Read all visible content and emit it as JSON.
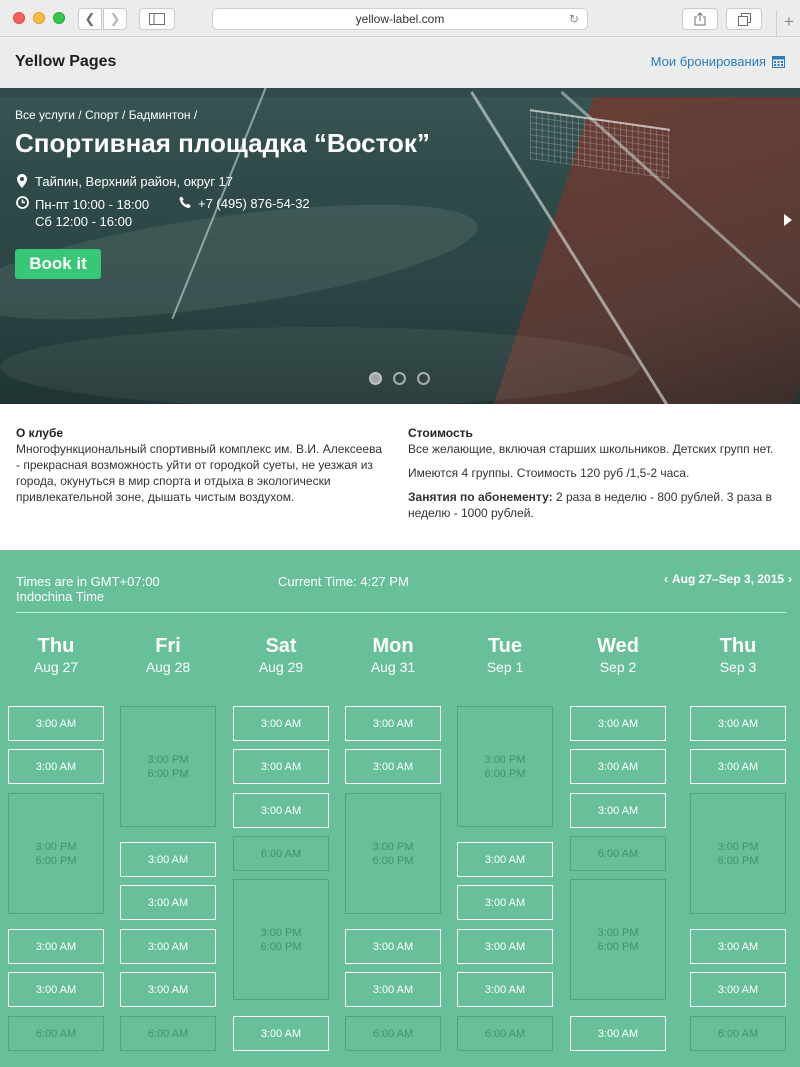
{
  "browser": {
    "url": "yellow-label.com",
    "newtab": "+"
  },
  "header": {
    "logo": "Yellow Pages",
    "my_bookings": "Мои бронирования"
  },
  "hero": {
    "breadcrumb": "Все услуги / Спорт / Бадминтон /",
    "title": "Спортивная площадка “Восток”",
    "address": "Тайпин, Верхний район, округ 17",
    "hours_1": "Пн-пт 10:00 - 18:00",
    "hours_2": "Сб 12:00 - 16:00",
    "phone": "+7 (495) 876-54-32",
    "book_label": "Book it",
    "active_slide": 1,
    "slide_count": 3
  },
  "about": {
    "heading": "О клубе",
    "text": "Многофункциональный спортивный комплекс им. В.И. Алексеева - прекрасная возможность уйти от городкой суеты, не уезжая из города, окунуться в мир спорта и отдыха в экологически привлекательной зоне, дышать чистым воздухом."
  },
  "price": {
    "heading": "Стоимость",
    "line1": "Все желающие, включая старших школьников. Детских групп нет.",
    "line2": "Имеются 4 группы. Стоимость 120 руб /1,5-2 часа.",
    "line3_bold": "Занятия по абонементу:",
    "line3_rest": " 2 раза в неделю - 800 рублей. 3 раза в неделю - 1000 рублей."
  },
  "schedule": {
    "tz_1": "Times are in GMT+07:00",
    "tz_2": "Indochina Time",
    "current_time": "Current Time: 4:27 PM",
    "range": "Aug 27–Sep 3, 2015",
    "days": [
      {
        "name": "Thu",
        "date": "Aug 27"
      },
      {
        "name": "Fri",
        "date": "Aug 28"
      },
      {
        "name": "Sat",
        "date": "Aug 29"
      },
      {
        "name": "Mon",
        "date": "Aug 31"
      },
      {
        "name": "Tue",
        "date": "Sep 1"
      },
      {
        "name": "Wed",
        "date": "Sep 2"
      },
      {
        "name": "Thu",
        "date": "Sep 3"
      }
    ],
    "slot_am": "3:00 AM",
    "slot_pm": "3:00 PM",
    "slot_pm2": "6:00 PM",
    "slot_6am": "6:00 AM"
  },
  "colors": {
    "accent_green": "#68c09a",
    "book_green": "#38c777",
    "link_blue": "#2a7bc0"
  }
}
